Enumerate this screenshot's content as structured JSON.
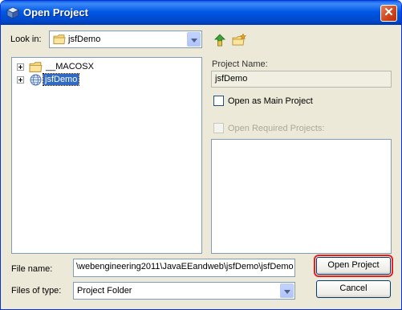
{
  "window": {
    "title": "Open Project",
    "close_glyph": "✕"
  },
  "look_in": {
    "label": "Look in:",
    "value": "jsfDemo",
    "icon": "folder-icon"
  },
  "toolbar": {
    "up_icon": "up-folder-icon",
    "new_folder_icon": "new-folder-icon"
  },
  "tree": {
    "items": [
      {
        "label": "__MACOSX",
        "icon": "folder-icon",
        "selected": false
      },
      {
        "label": "jsfDemo",
        "icon": "globe-project-icon",
        "selected": true
      }
    ]
  },
  "project": {
    "name_label": "Project Name:",
    "name_value": "jsfDemo",
    "main_checkbox_label": "Open as Main Project",
    "required_checkbox_label": "Open Required Projects:"
  },
  "file_name": {
    "label": "File name:",
    "value": "\\webengineering2011\\JavaEEandweb\\jsfDemo\\jsfDemo"
  },
  "files_of_type": {
    "label": "Files of type:",
    "value": "Project Folder"
  },
  "buttons": {
    "open": "Open Project",
    "cancel": "Cancel"
  },
  "colors": {
    "title_bar": "#0058E6",
    "selection": "#316AC5",
    "dialog_bg": "#ECE9D8",
    "default_outline": "#E4202A"
  }
}
